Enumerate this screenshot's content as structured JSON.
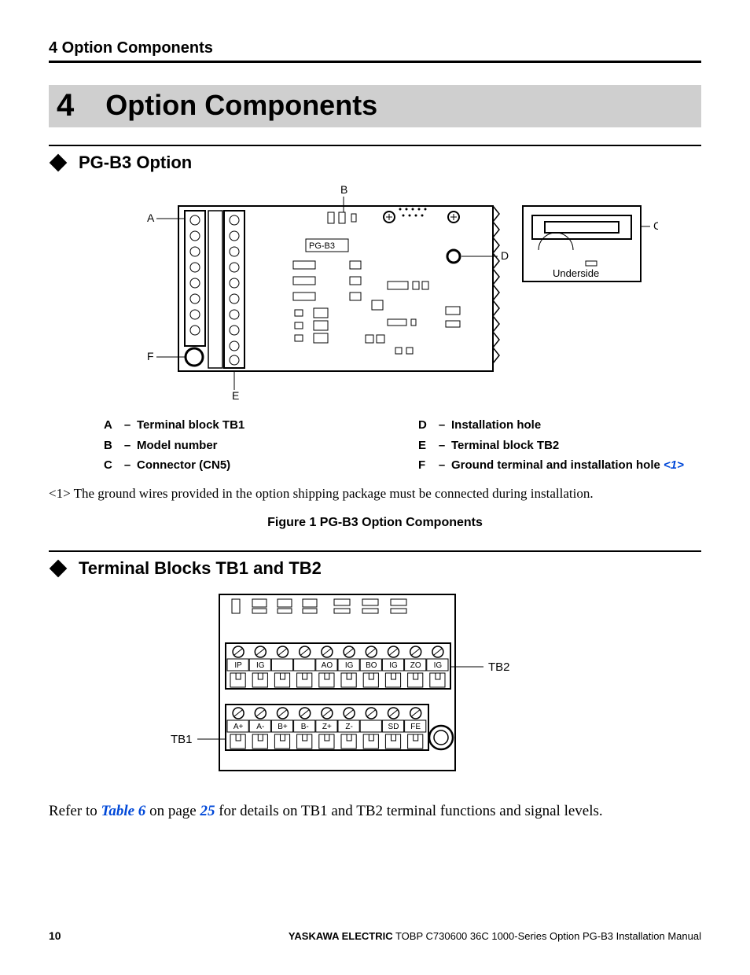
{
  "running_head": "4  Option Components",
  "chapter": {
    "num": "4",
    "title": "Option Components"
  },
  "section1": {
    "title": "PG-B3 Option"
  },
  "fig1": {
    "labels": {
      "A": "A",
      "B": "B",
      "C": "C",
      "D": "D",
      "E": "E",
      "F": "F"
    },
    "board_label": "PG-B3",
    "underside": "Underside",
    "caption": "Figure 1  PG-B3 Option Components"
  },
  "legend_left": [
    {
      "l": "A",
      "t": "Terminal block TB1"
    },
    {
      "l": "B",
      "t": "Model number"
    },
    {
      "l": "C",
      "t": "Connector (CN5)"
    }
  ],
  "legend_right": [
    {
      "l": "D",
      "t": "Installation hole"
    },
    {
      "l": "E",
      "t": "Terminal block TB2"
    },
    {
      "l": "F",
      "t": "Ground terminal and installation hole ",
      "ref": "<1>"
    }
  ],
  "footnote": "<1> The ground wires provided in the option shipping package must be connected during installation.",
  "section2": {
    "title": "Terminal Blocks TB1 and TB2"
  },
  "fig2": {
    "tb1": "TB1",
    "tb2": "TB2",
    "row_top": [
      "IP",
      "IG",
      "",
      "",
      "AO",
      "IG",
      "BO",
      "IG",
      "ZO",
      "IG"
    ],
    "row_bot": [
      "A+",
      "A-",
      "B+",
      "B-",
      "Z+",
      "Z-",
      "",
      "SD",
      "FE"
    ]
  },
  "paragraph": {
    "pre": "Refer to ",
    "link1": "Table 6",
    "mid": " on page ",
    "link2": "25",
    "post": " for details on TB1 and TB2 terminal functions and signal levels."
  },
  "footer": {
    "page": "10",
    "brand": "YASKAWA ELECTRIC",
    "doc": " TOBP C730600 36C 1000-Series Option PG-B3 Installation Manual"
  }
}
